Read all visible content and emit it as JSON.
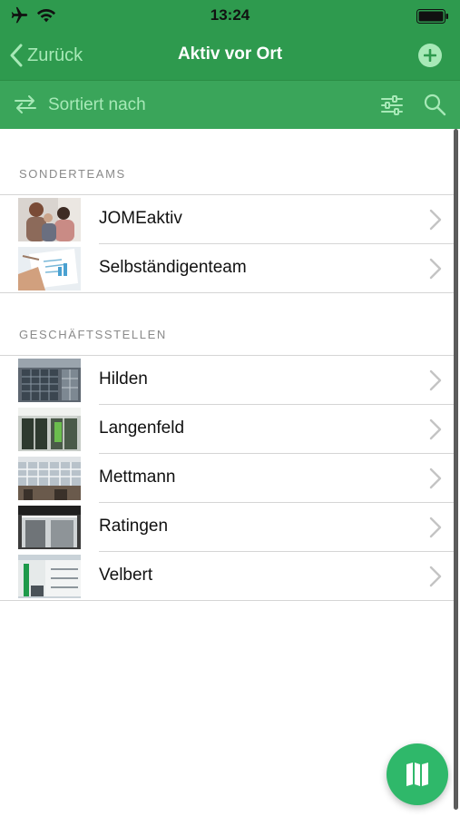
{
  "status_bar": {
    "time": "13:24"
  },
  "nav": {
    "back_label": "Zurück",
    "title": "Aktiv vor Ort"
  },
  "toolbar": {
    "sort_label": "Sortiert nach"
  },
  "sections": [
    {
      "header": "SONDERTEAMS",
      "items": [
        {
          "label": "JOMEaktiv",
          "thumb": "team-photo"
        },
        {
          "label": "Selbständigenteam",
          "thumb": "document-photo"
        }
      ]
    },
    {
      "header": "GESCHÄFTSSTELLEN",
      "items": [
        {
          "label": "Hilden",
          "thumb": "building-photo"
        },
        {
          "label": "Langenfeld",
          "thumb": "storefront-photo"
        },
        {
          "label": "Mettmann",
          "thumb": "building-photo"
        },
        {
          "label": "Ratingen",
          "thumb": "storefront-photo"
        },
        {
          "label": "Velbert",
          "thumb": "building-photo"
        }
      ]
    }
  ],
  "colors": {
    "header_green": "#2e9a4e",
    "toolbar_green": "#3aa55a",
    "accent_light_green": "#a7e9b7",
    "fab_green": "#2fb86a"
  },
  "icons": {
    "status_left": [
      "airplane-icon",
      "wifi-icon"
    ],
    "status_right": "battery-icon",
    "nav_back": "chevron-left-icon",
    "nav_right": "plus-circle-icon",
    "toolbar_left": "sort-arrows-icon",
    "toolbar_right": [
      "filter-sliders-icon",
      "search-icon"
    ],
    "row_accessory": "chevron-right-icon",
    "fab": "map-icon"
  }
}
